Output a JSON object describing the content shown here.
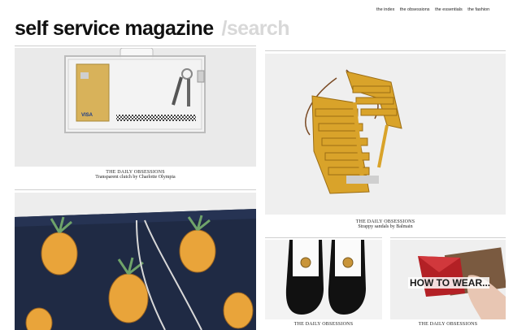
{
  "nav": {
    "links": [
      "the index",
      "the obsessions",
      "the essentials",
      "the fashion"
    ]
  },
  "brand": {
    "name": "self service magazine",
    "section": "/search"
  },
  "posts": [
    {
      "title": "THE DAILY OBSESSIONS",
      "subtitle": "Transparent clutch by Charlotte Olympia"
    },
    {
      "title": "THE DAILY OBSESSIONS",
      "subtitle": "Strappy sandals by Balmain"
    },
    {
      "title": "THE DAILY OBSESSIONS",
      "subtitle": ""
    },
    {
      "title": "THE DAILY OBSESSIONS",
      "subtitle": ""
    }
  ],
  "banner": {
    "text": "HOW TO WEAR..."
  },
  "card": {
    "brand": "VISA"
  },
  "colors": {
    "page": "#ffffff",
    "photo_bg": "#ececec",
    "sandal": "#d9a32a",
    "pineapple": "#e9a43a",
    "shorts_bg": "#1f2a44",
    "clutch_red": "#b32025"
  }
}
